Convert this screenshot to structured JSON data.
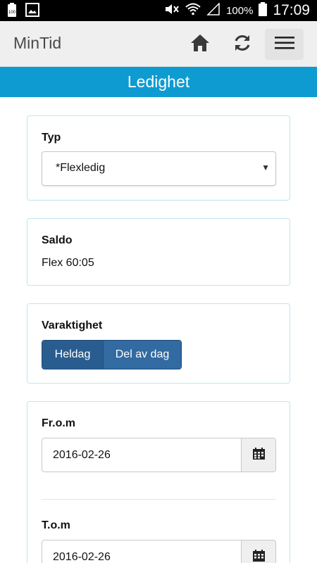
{
  "status_bar": {
    "battery_pct": "100%",
    "clock": "17:09",
    "battery_small_label": "100"
  },
  "app_bar": {
    "title": "MinTid",
    "icons": [
      "home-icon",
      "refresh-icon",
      "hamburger-menu-icon"
    ]
  },
  "page": {
    "title": "Ledighet"
  },
  "typ": {
    "label": "Typ",
    "selected": "*Flexledig"
  },
  "saldo": {
    "label": "Saldo",
    "value": "Flex 60:05"
  },
  "varaktighet": {
    "label": "Varaktighet",
    "options": [
      "Heldag",
      "Del av dag"
    ],
    "selected": "Heldag"
  },
  "dates": {
    "from_label": "Fr.o.m",
    "from_value": "2016-02-26",
    "to_label": "T.o.m",
    "to_value": "2016-02-26"
  },
  "colors": {
    "header_blue": "#0e9bd1",
    "toggle_blue": "#2a5d8f",
    "card_border": "#bfe6ee"
  }
}
